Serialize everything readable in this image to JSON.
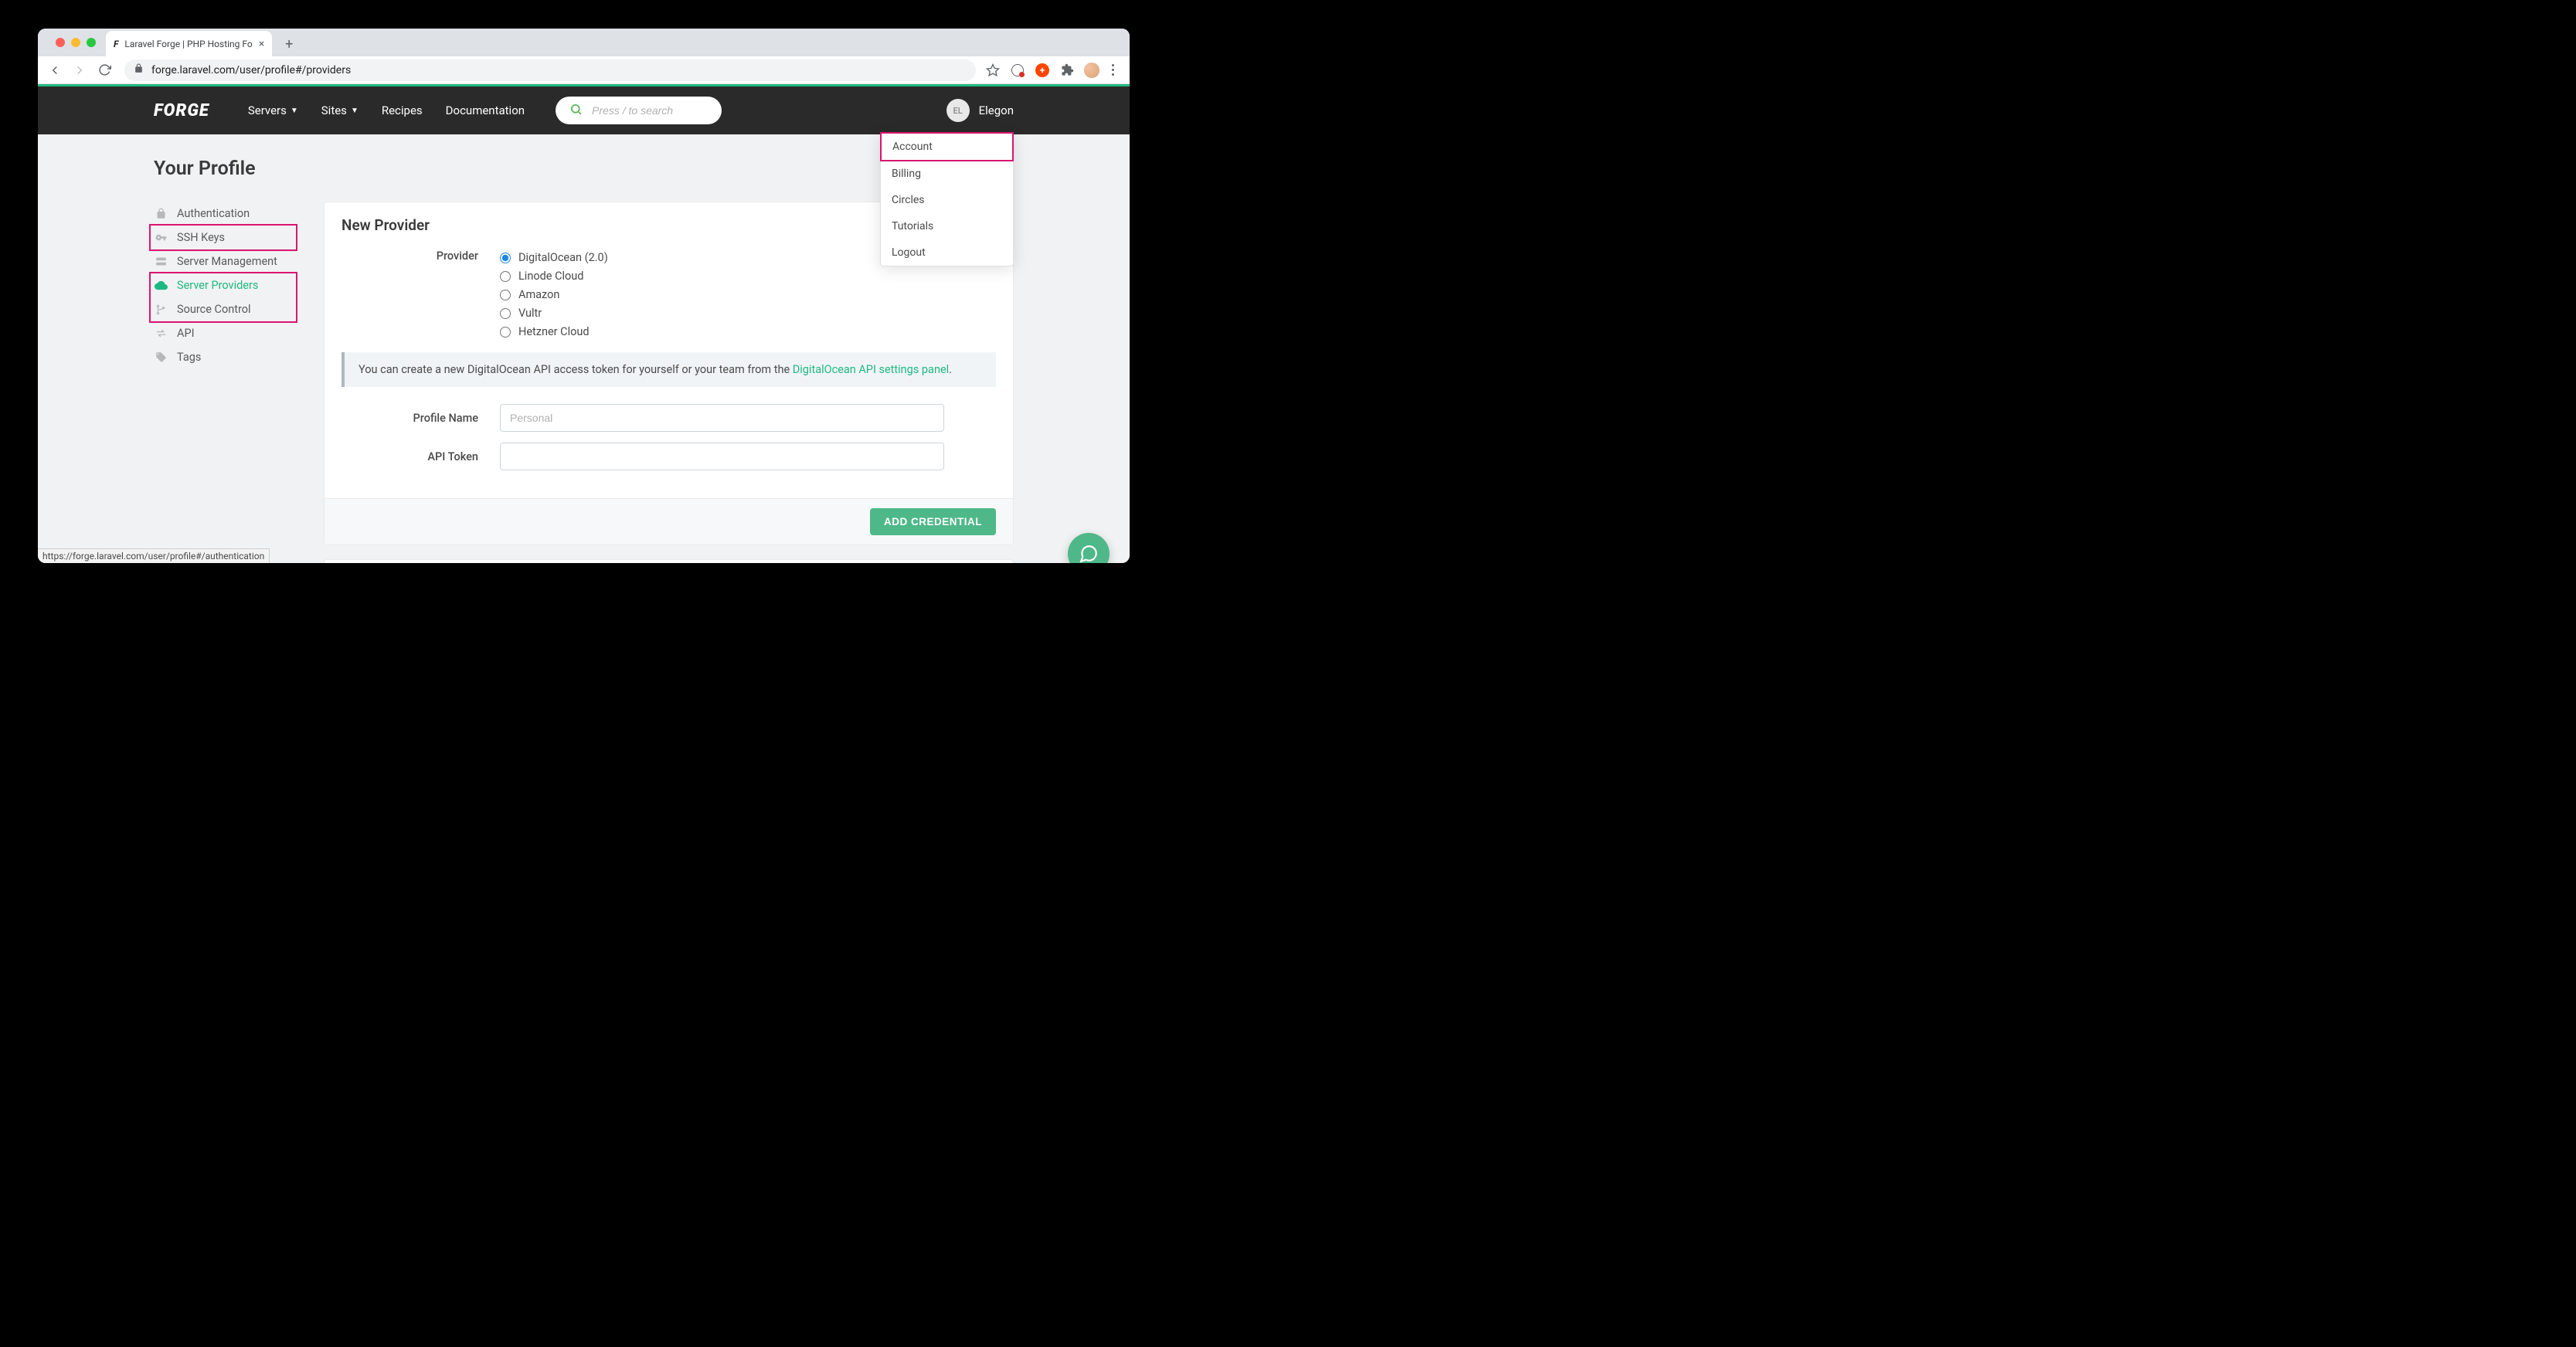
{
  "browser": {
    "tab_title": "Laravel Forge | PHP Hosting Fo",
    "url_display": "forge.laravel.com/user/profile#/providers",
    "status_link": "https://forge.laravel.com/user/profile#/authentication"
  },
  "header": {
    "logo": "FORGE",
    "nav": {
      "servers": "Servers",
      "sites": "Sites",
      "recipes": "Recipes",
      "documentation": "Documentation"
    },
    "search_placeholder": "Press / to search",
    "user_initials": "EL",
    "user_name": "Elegon"
  },
  "dropdown": {
    "account": "Account",
    "billing": "Billing",
    "circles": "Circles",
    "tutorials": "Tutorials",
    "logout": "Logout"
  },
  "page": {
    "title": "Your Profile"
  },
  "sidebar": {
    "authentication": "Authentication",
    "ssh_keys": "SSH Keys",
    "server_management": "Server Management",
    "server_providers": "Server Providers",
    "source_control": "Source Control",
    "api": "API",
    "tags": "Tags"
  },
  "card": {
    "title": "New Provider",
    "provider_label": "Provider",
    "providers": {
      "digitalocean": "DigitalOcean (2.0)",
      "linode": "Linode Cloud",
      "amazon": "Amazon",
      "vultr": "Vultr",
      "hetzner": "Hetzner Cloud"
    },
    "info_text": "You can create a new DigitalOcean API access token for yourself or your team from the ",
    "info_link": "DigitalOcean API settings panel",
    "info_end": ".",
    "profile_name_label": "Profile Name",
    "profile_name_placeholder": "Personal",
    "api_token_label": "API Token",
    "button": "ADD CREDENTIAL"
  }
}
